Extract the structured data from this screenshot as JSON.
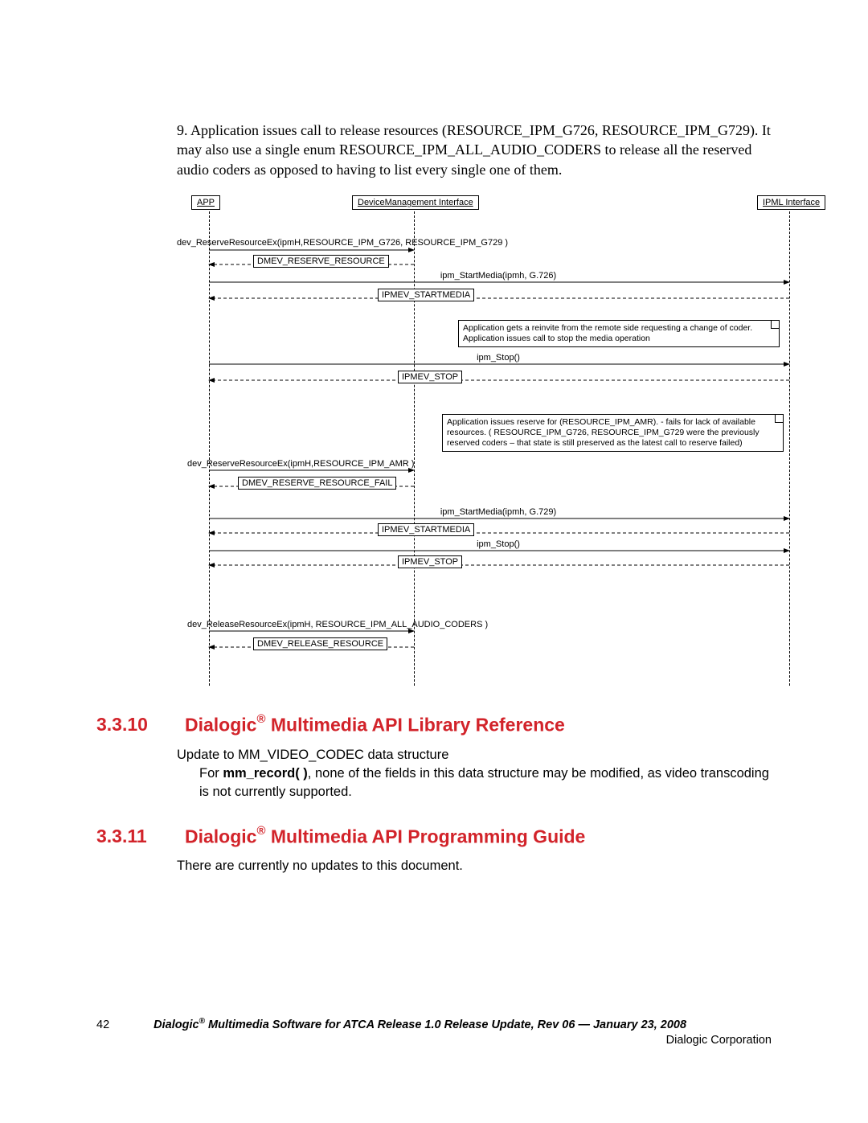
{
  "intro": {
    "text": "9. Application issues call to release resources (RESOURCE_IPM_G726, RESOURCE_IPM_G729). It may also use a single enum RESOURCE_IPM_ALL_AUDIO_CODERS to release all the reserved audio coders as opposed to having to list every single one of them."
  },
  "diagram": {
    "lifelines": {
      "app": "APP",
      "dmi": "DeviceManagement Interface",
      "ipml": "IPML Interface"
    },
    "calls": {
      "c1": "dev_ReserveResourceEx(ipmH,RESOURCE_IPM_G726, RESOURCE_IPM_G729 )",
      "e1": "DMEV_RESERVE_RESOURCE",
      "c2": "ipm_StartMedia(ipmh, G.726)",
      "e2": "IPMEV_STARTMEDIA",
      "c3": "ipm_Stop()",
      "e3": "IPMEV_STOP",
      "c4": "dev_ReserveResourceEx(ipmH,RESOURCE_IPM_AMR )",
      "e4": "DMEV_RESERVE_RESOURCE_FAIL",
      "c5": "ipm_StartMedia(ipmh, G.729)",
      "e5": "IPMEV_STARTMEDIA",
      "c6": "ipm_Stop()",
      "e6": "IPMEV_STOP",
      "c7": "dev_ReleaseResourceEx(ipmH, RESOURCE_IPM_ALL_AUDIO_CODERS )",
      "e7": "DMEV_RELEASE_RESOURCE"
    },
    "notes": {
      "n1": "Application gets a reinvite from the remote side requesting a change of coder. Application issues call to stop the media operation",
      "n2": "Application issues reserve for (RESOURCE_IPM_AMR). - fails for lack of available resources. ( RESOURCE_IPM_G726, RESOURCE_IPM_G729 were the previously reserved coders – that state is still preserved as the latest call to reserve failed)"
    }
  },
  "section_3310": {
    "num": "3.3.10",
    "title_pre": "Dialogic",
    "title_post": " Multimedia API Library Reference",
    "line1": "Update to MM_VIDEO_CODEC data structure",
    "line2_pre": "For ",
    "line2_bold": "mm_record( )",
    "line2_post": ", none of the fields in this data structure may be modified, as video transcoding is not currently supported."
  },
  "section_3311": {
    "num": "3.3.11",
    "title_pre": "Dialogic",
    "title_post": " Multimedia API Programming Guide",
    "body": "There are currently no updates to this document."
  },
  "footer": {
    "page_num": "42",
    "title_pre": "Dialogic",
    "title_post": " Multimedia Software for ATCA Release 1.0 Release Update, Rev 06  — January 23, 2008",
    "corp": "Dialogic Corporation"
  }
}
